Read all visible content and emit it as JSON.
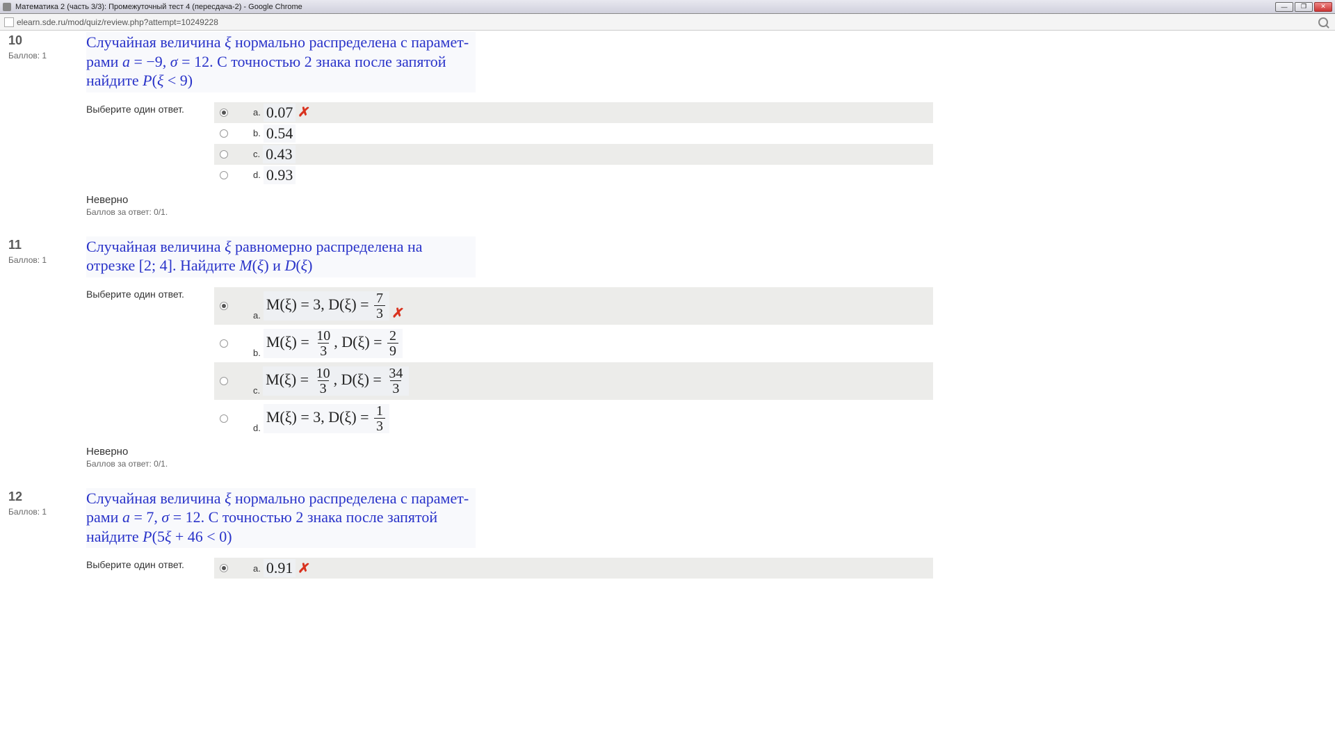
{
  "window": {
    "title": "Математика 2 (часть 3/3): Промежуточный тест 4 (пересдача-2) - Google Chrome",
    "url": "elearn.sde.ru/mod/quiz/review.php?attempt=10249228"
  },
  "labels": {
    "points_prefix": "Баллов: ",
    "choose_one": "Выберите один ответ.",
    "incorrect": "Неверно",
    "score_prefix": "Баллов за ответ: "
  },
  "questions": [
    {
      "number": "10",
      "points": "1",
      "text_html": "Случайная величина <span class='math-i'>ξ</span> нормально распределена с парамет-рами <span class='math-i'>a</span> = −9, <span class='math-i'>σ</span> = 12. С точностью 2 знака после запятой найдите <span class='math-i'>P</span>(<span class='math-i'>ξ</span> < 9)",
      "options": [
        {
          "letter": "a.",
          "value": "0.07",
          "selected": true,
          "wrong": true
        },
        {
          "letter": "b.",
          "value": "0.54",
          "selected": false,
          "wrong": false
        },
        {
          "letter": "c.",
          "value": "0.43",
          "selected": false,
          "wrong": false
        },
        {
          "letter": "d.",
          "value": "0.93",
          "selected": false,
          "wrong": false
        }
      ],
      "score": "0/1."
    },
    {
      "number": "11",
      "points": "1",
      "text_html": "Случайная величина <span class='math-i'>ξ</span> равномерно распределена на отрезке [2; 4]. Найдите <span class='math-i'>M</span>(<span class='math-i'>ξ</span>) и <span class='math-i'>D</span>(<span class='math-i'>ξ</span>)",
      "options": [
        {
          "letter": "a.",
          "formula": {
            "m_num": "",
            "m_whole": "3",
            "d_num": "7",
            "d_den": "3"
          },
          "selected": true,
          "wrong": true,
          "tall": true
        },
        {
          "letter": "b.",
          "formula": {
            "m_num": "10",
            "m_den": "3",
            "d_num": "2",
            "d_den": "9"
          },
          "selected": false,
          "wrong": false,
          "tall": true
        },
        {
          "letter": "c.",
          "formula": {
            "m_num": "10",
            "m_den": "3",
            "d_num": "34",
            "d_den": "3"
          },
          "selected": false,
          "wrong": false,
          "tall": true
        },
        {
          "letter": "d.",
          "formula": {
            "m_whole": "3",
            "d_num": "1",
            "d_den": "3"
          },
          "selected": false,
          "wrong": false,
          "tall": true
        }
      ],
      "score": "0/1."
    },
    {
      "number": "12",
      "points": "1",
      "text_html": "Случайная величина <span class='math-i'>ξ</span> нормально распределена с парамет-рами <span class='math-i'>a</span> = 7, <span class='math-i'>σ</span> = 12. С точностью 2 знака после запятой найдите <span class='math-i'>P</span>(5<span class='math-i'>ξ</span> + 46 < 0)",
      "options": [
        {
          "letter": "a.",
          "value": "0.91",
          "selected": true,
          "wrong": true
        }
      ],
      "score": ""
    }
  ]
}
